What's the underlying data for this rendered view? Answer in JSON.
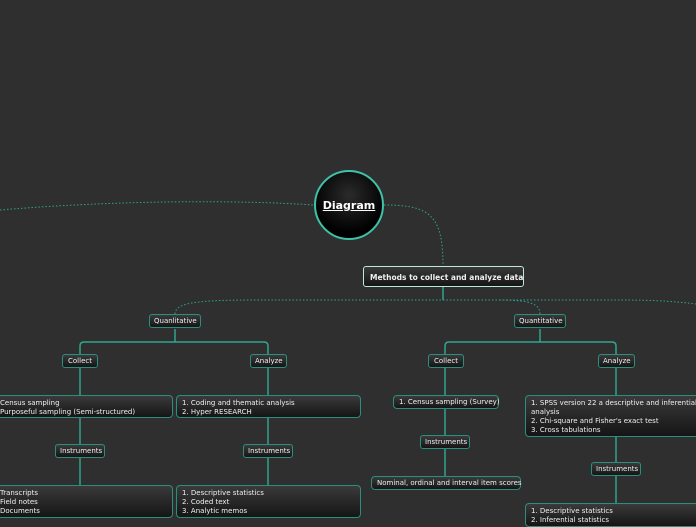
{
  "central_topic": "Diagram",
  "main_branch": "Methods to collect and analyze data",
  "qualitative": {
    "label": "Quanlitative",
    "collect": {
      "label": "Collect",
      "methods": [
        "Census sampling",
        "Purposeful sampling (Semi-structured)"
      ],
      "instruments_label": "Instruments",
      "instruments": [
        "Transcripts",
        "Field notes",
        "Documents"
      ]
    },
    "analyze": {
      "label": "Analyze",
      "methods": [
        "1. Coding and thematic analysis",
        "2. Hyper RESEARCH"
      ],
      "instruments_label": "Instruments",
      "instruments": [
        "1. Descriptive statistics",
        "2. Coded text",
        "3. Analytic memos"
      ]
    }
  },
  "quantitative": {
    "label": "Quantitative",
    "collect": {
      "label": "Collect",
      "methods": [
        "1. Census sampling (Survey)"
      ],
      "instruments_label": "Instruments",
      "instruments": [
        "Nominal, ordinal and interval item scores"
      ]
    },
    "analyze": {
      "label": "Analyze",
      "methods": [
        "1. SPSS version 22 a descriptive and inferential",
        "analysis",
        "2. Chi-square and Fisher's exact test",
        "3. Cross tabulations"
      ],
      "instruments_label": "Instruments",
      "instruments": [
        "1. Descriptive statistics",
        "2. Inferential statistics"
      ]
    }
  },
  "colors": {
    "background": "#2f2f2f",
    "connector": "#2fa58f",
    "border": "#2a8f7e"
  }
}
